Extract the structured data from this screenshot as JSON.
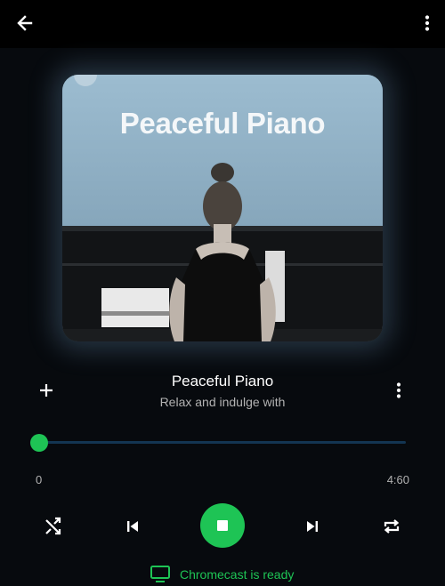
{
  "playlist": {
    "cover_text": "Peaceful Piano",
    "title": "Peaceful Piano",
    "subtitle": "Relax and indulge with"
  },
  "playback": {
    "elapsed": "0",
    "duration": "4:60",
    "progress_fraction": 0.0,
    "state": "playing"
  },
  "cast": {
    "label": "Chromecast is ready",
    "icon": "tv-cast-icon"
  },
  "icons": {
    "back": "arrow-left-icon",
    "menu": "more-vertical-icon",
    "add": "plus-icon",
    "more": "more-vertical-icon",
    "shuffle": "shuffle-icon",
    "previous": "skip-previous-icon",
    "stop": "stop-icon",
    "next": "skip-next-icon",
    "repeat": "repeat-icon"
  },
  "colors": {
    "accent": "#1ec455",
    "background": "#070a0e",
    "topbar": "#000000",
    "secondary_text": "#b3b3b3",
    "progress_track": "#133552"
  }
}
